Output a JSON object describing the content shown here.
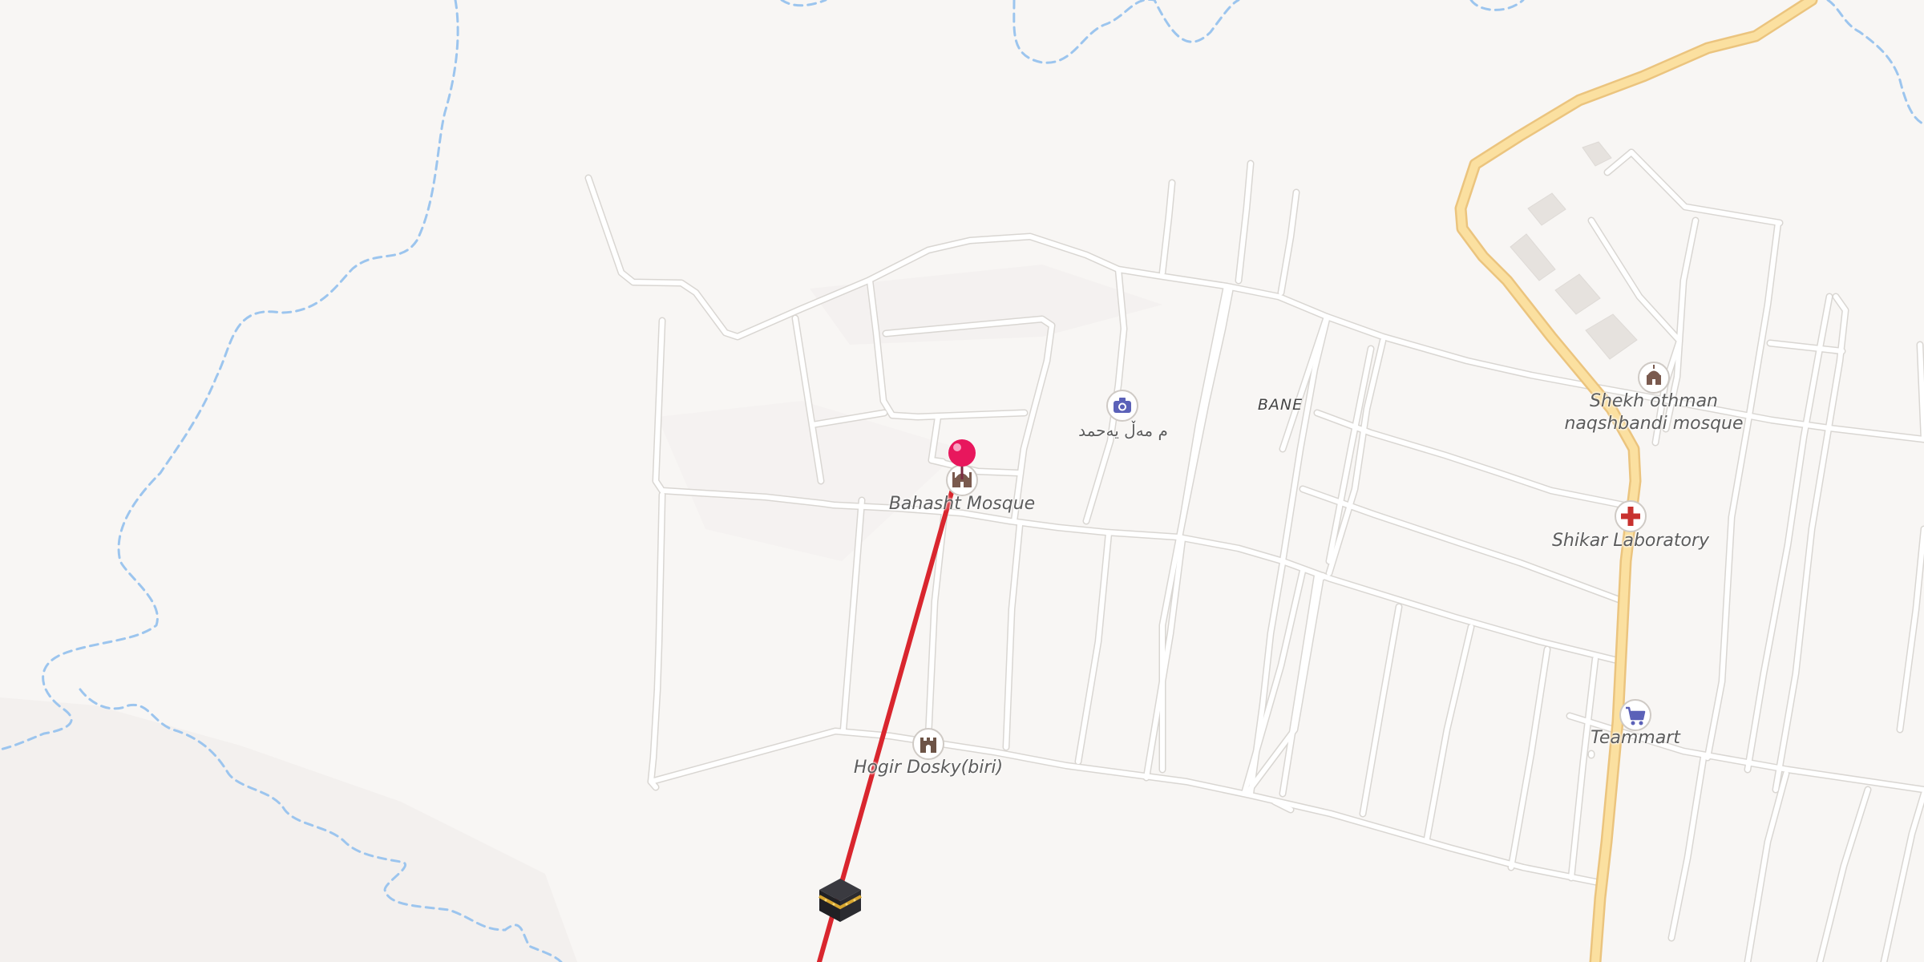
{
  "map": {
    "area_label": "BANE",
    "pois": [
      {
        "key": "bahasht",
        "label": "Bahasht Mosque",
        "icon": "mosque-icon"
      },
      {
        "key": "shekh",
        "label": "Shekh othman naqshbandi mosque",
        "label_lines": [
          "Shekh othman",
          "naqshbandi mosque"
        ],
        "icon": "mosque-icon"
      },
      {
        "key": "shikar",
        "label": "Shikar Laboratory",
        "icon": "medical-cross-icon"
      },
      {
        "key": "teammart",
        "label": "Teammart",
        "icon": "shopping-cart-icon"
      },
      {
        "key": "hogir",
        "label": "Hogir Dosky(biri)",
        "icon": "castle-icon"
      },
      {
        "key": "viewpoint",
        "label": "م مەڵ یەحمد",
        "icon": "camera-icon"
      }
    ],
    "markers": {
      "location_pin": {
        "icon": "location-pin-icon",
        "color": "#e8175d"
      },
      "qibla_kaaba": {
        "icon": "kaaba-icon"
      }
    },
    "colors": {
      "background": "#f8f6f4",
      "road_fill": "#ffffff",
      "road_casing": "#d9d6d2",
      "main_road": "#fbe0a0",
      "main_road_casing": "#ebc47e",
      "stream": "#9cc5ee",
      "qibla_line": "#d9262e",
      "building": "#e6e2de"
    }
  }
}
